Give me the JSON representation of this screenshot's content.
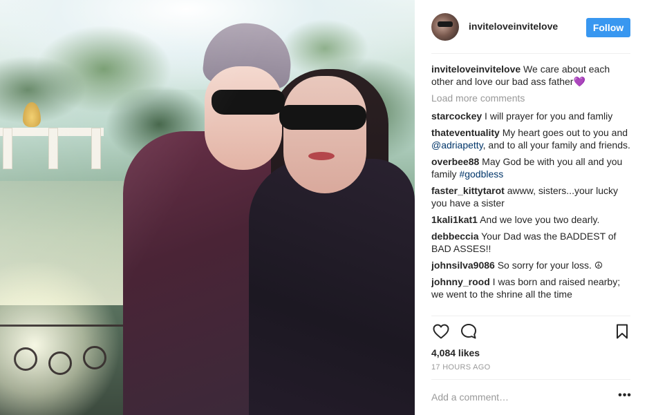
{
  "post": {
    "username": "inviteloveinvitelove",
    "follow_label": "Follow",
    "caption_user": "inviteloveinvitelove",
    "caption_text": " We care about each other and love our bad ass father💜",
    "load_more": "Load more comments",
    "likes": "4,084 likes",
    "timestamp": "17 HOURS AGO",
    "comment_placeholder": "Add a comment…",
    "more_label": "•••"
  },
  "comments": [
    {
      "user": "starcockey",
      "text": " I will prayer for you and famliy"
    },
    {
      "user": "thateventuality",
      "text_before": " My heart goes out to you and ",
      "mention": "@adriapetty",
      "text_after": ", and to all your family and friends."
    },
    {
      "user": "overbee88",
      "text_before": " May God be with you all and you family ",
      "mention": "#godbless",
      "text_after": ""
    },
    {
      "user": "faster_kittytarot",
      "text": " awww, sisters...your lucky you have a sister"
    },
    {
      "user": "1kali1kat1",
      "text": " And we love you two dearly."
    },
    {
      "user": "debbeccia",
      "text": " Your Dad was the BADDEST of BAD ASSES!!"
    },
    {
      "user": "johnsilva9086",
      "text": " So sorry for your loss. ☮"
    },
    {
      "user": "johnny_rood",
      "text": " I was born and raised nearby; we went to the shrine all the time"
    }
  ],
  "icons": {
    "like": "heart-icon",
    "comment": "comment-bubble-icon",
    "save": "bookmark-icon",
    "avatar": "profile-avatar"
  },
  "colors": {
    "follow_button": "#3897f0",
    "text": "#262626",
    "muted": "#999999",
    "mention": "#003569"
  }
}
